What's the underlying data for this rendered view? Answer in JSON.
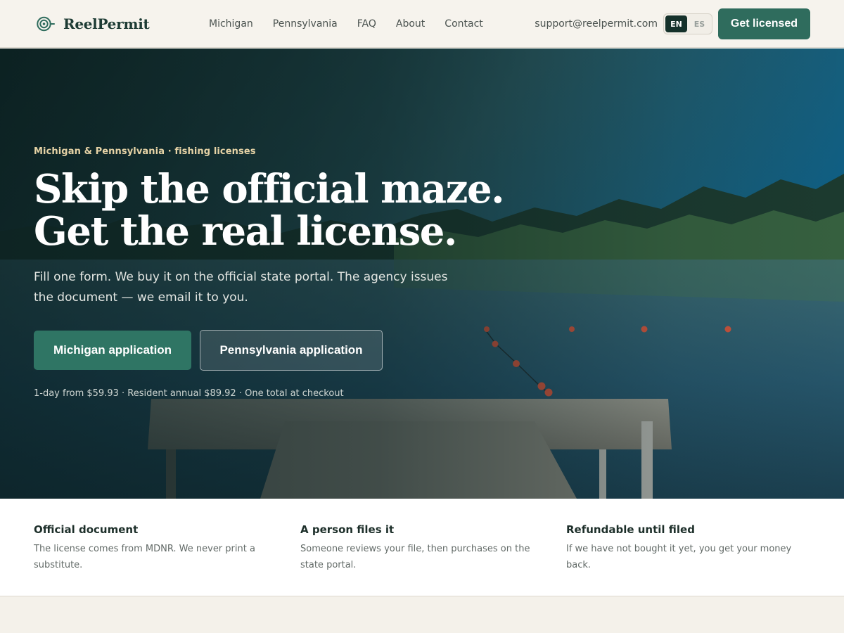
{
  "brand": {
    "name": "ReelPermit",
    "icon": "spiral-logo-icon"
  },
  "nav": {
    "items": [
      "Michigan",
      "Pennsylvania",
      "FAQ",
      "About",
      "Contact"
    ]
  },
  "header": {
    "support_email": "support@reelpermit.com",
    "lang_options": [
      "EN",
      "ES"
    ],
    "lang_selected": "EN",
    "cta_label": "Get licensed"
  },
  "hero": {
    "eyebrow": "Michigan & Pennsylvania · fishing licenses",
    "headline": "Skip the official maze. Get the real license.",
    "lede": "Fill one form. We buy it on the official state portal. The agency issues the document — we email it to you.",
    "primary_button": "Michigan application",
    "secondary_button": "Pennsylvania application",
    "pricing_note": "1-day from $59.93 · Resident annual $89.92 · One total at checkout"
  },
  "features": [
    {
      "title": "Official document",
      "body": "The license comes from MDNR. We never print a substitute."
    },
    {
      "title": "A person files it",
      "body": "Someone reviews your file, then purchases on the state portal."
    },
    {
      "title": "Refundable until filed",
      "body": "If we have not bought it yet, you get your money back."
    }
  ],
  "colors": {
    "accent": "#2f6c5d",
    "brand_dark": "#1d3b34",
    "eyebrow": "#e6d3a6"
  }
}
